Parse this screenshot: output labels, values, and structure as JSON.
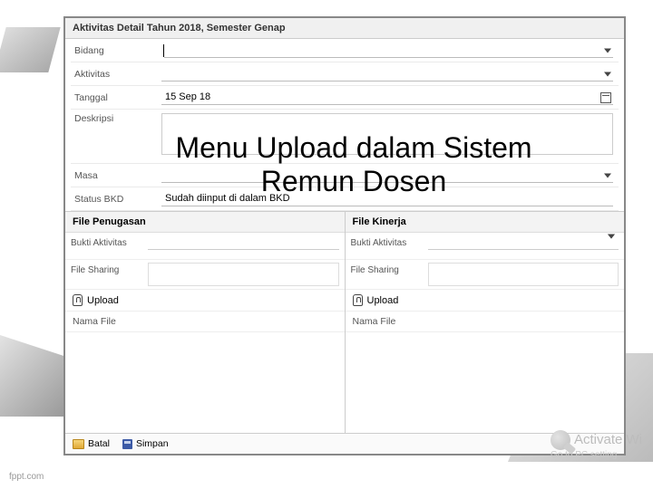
{
  "window": {
    "title": "Aktivitas Detail Tahun 2018, Semester Genap"
  },
  "form": {
    "bidang": {
      "label": "Bidang",
      "value": ""
    },
    "aktivitas": {
      "label": "Aktivitas",
      "value": ""
    },
    "tanggal": {
      "label": "Tanggal",
      "value": "15 Sep 18"
    },
    "deskripsi": {
      "label": "Deskripsi",
      "value": ""
    },
    "masa": {
      "label": "Masa",
      "value": ""
    },
    "status": {
      "label": "Status BKD",
      "value": "Sudah diinput di dalam BKD"
    }
  },
  "penugasan": {
    "title": "File Penugasan",
    "bukti_label": "Bukti Aktivitas",
    "share_label": "File Sharing",
    "upload_label": "Upload",
    "namafile_label": "Nama File"
  },
  "kinerja": {
    "title": "File Kinerja",
    "bukti_label": "Bukti Aktivitas",
    "share_label": "File Sharing",
    "upload_label": "Upload",
    "namafile_label": "Nama File"
  },
  "actions": {
    "batal": "Batal",
    "simpan": "Simpan"
  },
  "overlay": "Menu Upload dalam Sistem Remun Dosen",
  "watermark": {
    "line1": "Activate Wi",
    "line2": "Go to PC setting"
  },
  "footer": "fppt.com"
}
